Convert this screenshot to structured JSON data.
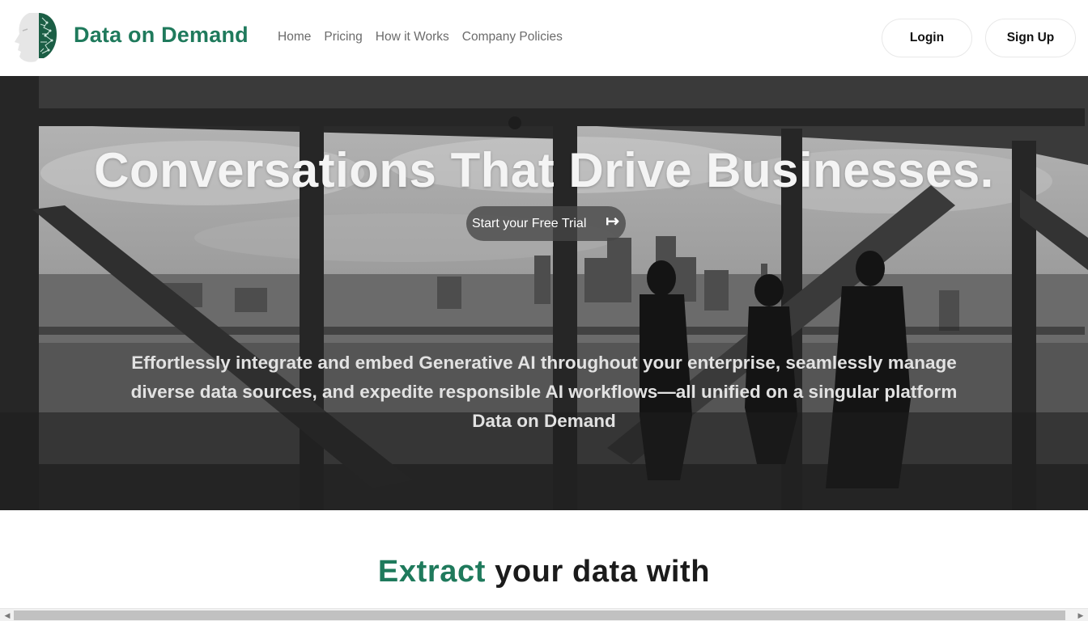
{
  "navbar": {
    "brand": "Data on Demand",
    "logo_icon": "ai-head-logo-icon",
    "links": [
      {
        "label": "Home"
      },
      {
        "label": "Pricing"
      },
      {
        "label": "How it Works"
      },
      {
        "label": "Company Policies"
      }
    ],
    "login_label": "Login",
    "signup_label": "Sign Up"
  },
  "hero": {
    "title": "Conversations That Drive Businesses.",
    "cta_label": "Start your Free Trial",
    "cta_icon": "arrow-right-to-bar-icon",
    "cta_icon_glyph": "↦",
    "subtitle": "Effortlessly integrate and embed Generative AI throughout your enterprise, seamlessly manage diverse data sources, and expedite responsible AI workflows—all unified on a singular platform Data on Demand",
    "background_description": "Black and white photo of people silhouetted in an office overlooking a city skyline"
  },
  "section": {
    "heading_accent": "Extract",
    "heading_rest": " your data with"
  },
  "scrollbar": {
    "left_glyph": "◀",
    "right_glyph": "▶"
  },
  "colors": {
    "brand_green": "#1f7a5c",
    "nav_text": "#6b6b6b"
  }
}
